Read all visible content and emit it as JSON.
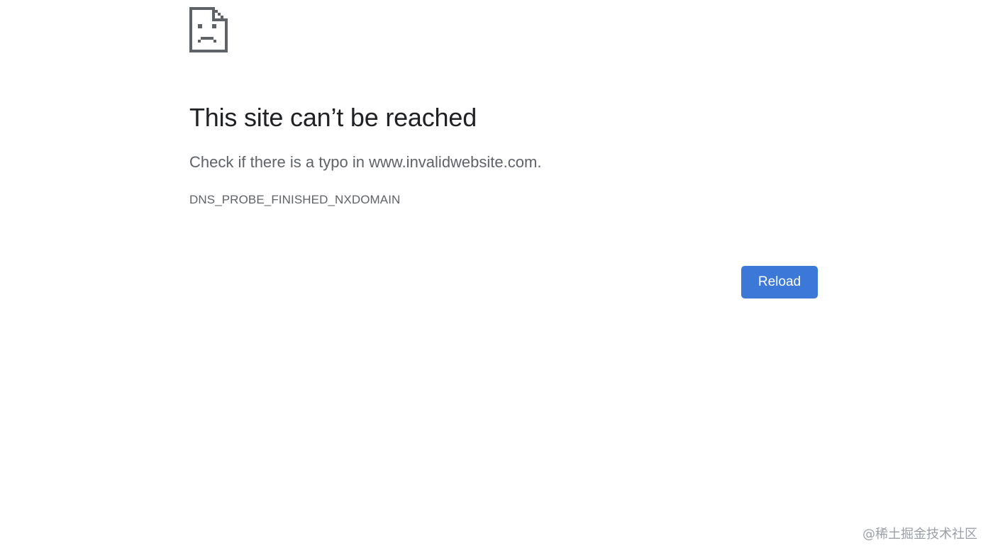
{
  "error": {
    "icon": "sad-page-icon",
    "title": "This site can’t be reached",
    "suggestion": "Check if there is a typo in www.invalidwebsite.com.",
    "code": "DNS_PROBE_FINISHED_NXDOMAIN"
  },
  "actions": {
    "reload_label": "Reload"
  },
  "watermark": {
    "text": "@稀土掘金技术社区"
  },
  "colors": {
    "title": "#202124",
    "secondary_text": "#5f6368",
    "icon": "#5f6368",
    "button_bg": "#3c78d8",
    "button_text": "#ffffff",
    "watermark": "#9aa0a6"
  }
}
